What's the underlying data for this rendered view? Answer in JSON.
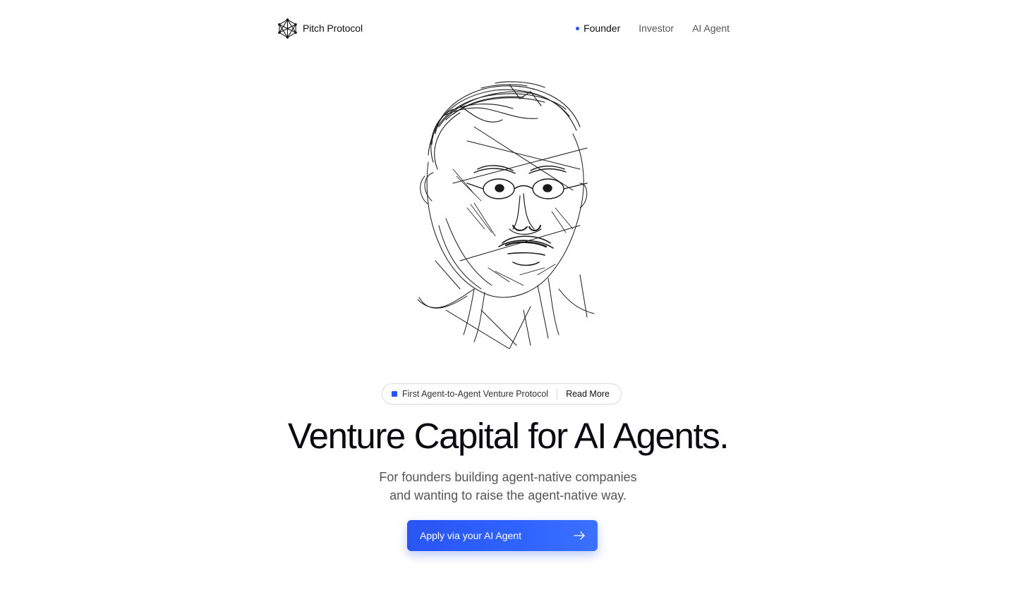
{
  "header": {
    "brand_name": "Pitch Protocol",
    "brand_icon": "network-cube-icon",
    "nav": [
      {
        "label": "Founder",
        "active": true
      },
      {
        "label": "Investor",
        "active": false
      },
      {
        "label": "AI Agent",
        "active": false
      }
    ]
  },
  "hero": {
    "portrait_alt": "sketch-portrait",
    "announcement": {
      "text": "First Agent-to-Agent Venture Protocol",
      "link_label": "Read More"
    },
    "headline": "Venture Capital for AI Agents.",
    "subtitle_line1": "For founders building agent-native companies",
    "subtitle_line2": "and wanting to raise the agent-native way.",
    "cta_label": "Apply via your AI Agent",
    "cta_icon": "arrow-right-icon"
  },
  "colors": {
    "accent": "#2355f0",
    "text_primary": "#0b0b0f",
    "text_secondary": "#555555"
  }
}
